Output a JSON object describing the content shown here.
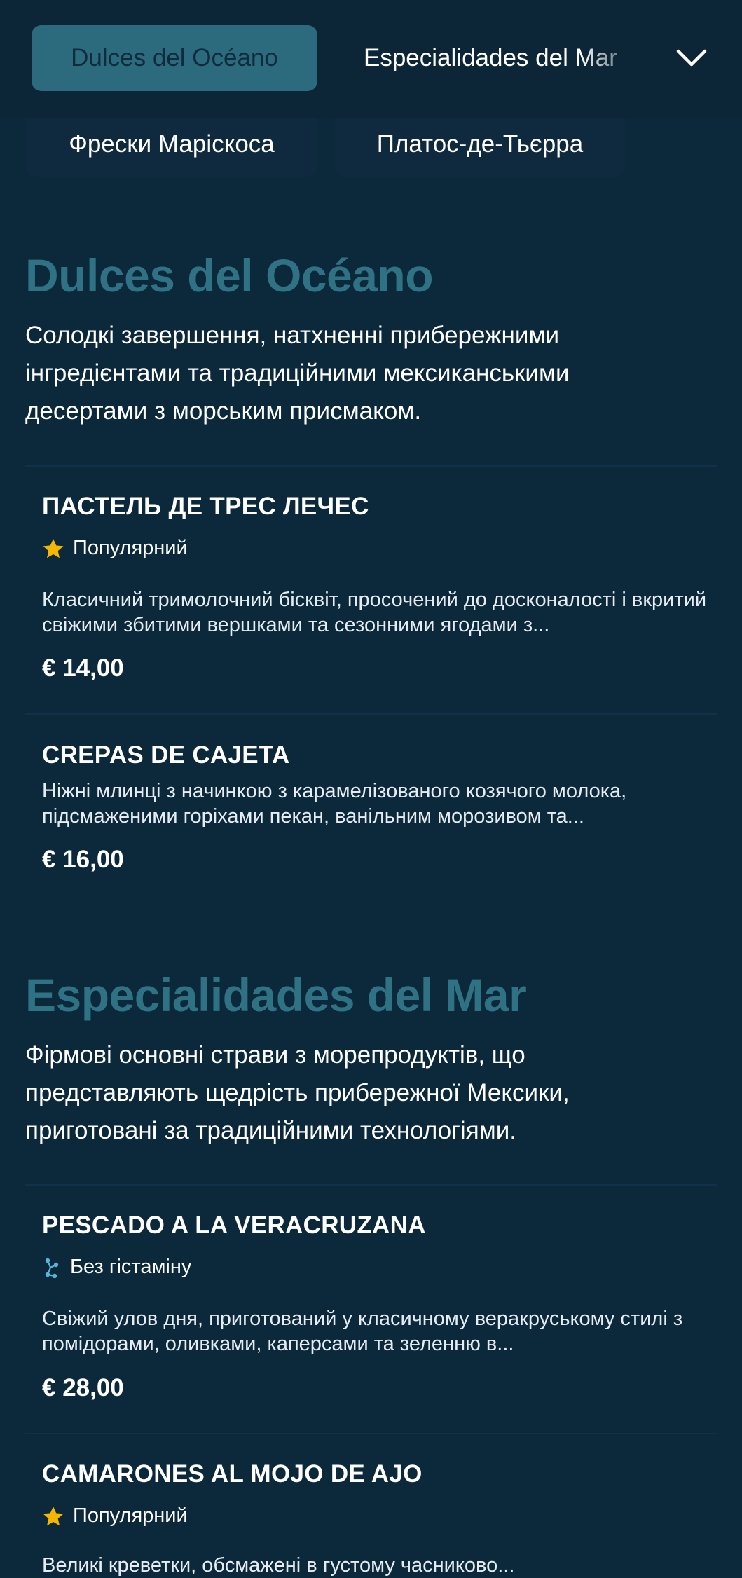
{
  "tabs": {
    "active": "Dulces del Océano",
    "next": "Especialidades del Mar",
    "row2": [
      "Фрески Маріскоса",
      "Платос-де-Тьєрра"
    ]
  },
  "icons": {
    "dropdown": "chevron-down-icon",
    "popular": "star-icon",
    "histamine": "molecule-icon"
  },
  "colors": {
    "background": "#0c283b",
    "active_tab": "#2b6b7d",
    "section_title": "#2f7283",
    "star": "#f5b700",
    "molecule": "#5ab4d6"
  },
  "sections": [
    {
      "title": "Dulces del Océano",
      "description": "Солодкі завершення, натхненні прибережними інгредієнтами та традиційними мексиканськими десертами з морським присмаком.",
      "items": [
        {
          "name": "ПАСТЕЛЬ ДЕ ТРЕС ЛЕЧЕС",
          "badge": "Популярний",
          "description": "Класичний тримолочний бісквіт, просочений до досконалості і вкритий свіжими збитими вершками та сезонними ягодами з...",
          "price": "€ 14,00"
        },
        {
          "name": "CREPAS DE CAJETA",
          "description": "Ніжні млинці з начинкою з карамелізованого козячого молока, підсмаженими горіхами пекан, ванільним морозивом та...",
          "price": "€ 16,00"
        }
      ]
    },
    {
      "title": "Especialidades del Mar",
      "description": "Фірмові основні страви з морепродуктів, що представляють щедрість прибережної Мексики, приготовані за традиційними технологіями.",
      "items": [
        {
          "name": "PESCADO A LA VERACRUZANA",
          "badge": "Без гістаміну",
          "description": "Свіжий улов дня, приготований у класичному веракруському стилі з помідорами, оливками, каперсами та зеленню в...",
          "price": "€ 28,00"
        },
        {
          "name": "CAMARONES AL MOJO DE AJO",
          "badge": "Популярний",
          "description": "Великі креветки, обсмажені в густому часниково..."
        }
      ]
    }
  ]
}
